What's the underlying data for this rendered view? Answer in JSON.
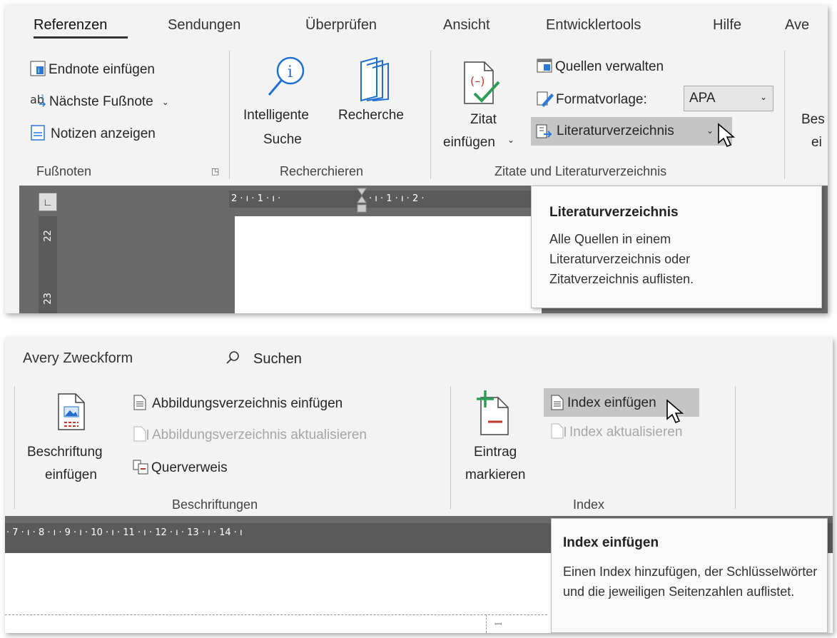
{
  "panel1": {
    "tabs": [
      "Referenzen",
      "Sendungen",
      "Überprüfen",
      "Ansicht",
      "Entwicklertools",
      "Hilfe",
      "Ave"
    ],
    "fussnoten": {
      "endnote": "Endnote einfügen",
      "naechste": "Nächste Fußnote",
      "notizen": "Notizen anzeigen",
      "group": "Fußnoten"
    },
    "recherche": {
      "intelligente_1": "Intelligente",
      "intelligente_2": "Suche",
      "recherche": "Recherche",
      "group": "Recherchieren"
    },
    "zitate": {
      "zitat_1": "Zitat",
      "zitat_2": "einfügen",
      "quellen": "Quellen verwalten",
      "formatvorlage": "Formatvorlage:",
      "style_value": "APA",
      "literatur": "Literaturverzeichnis",
      "group": "Zitate und Literaturverzeichnis"
    },
    "cut": {
      "l1": "Bes",
      "l2": "ei"
    },
    "ruler": {
      "h": "2 · ı · 1 · ı ·",
      "h2": "· ı · 1 · ı · 2 ·",
      "v1": "22",
      "v2": "23"
    },
    "tooltip": {
      "title": "Literaturverzeichnis",
      "body": "Alle Quellen in einem Literaturverzeichnis oder Zitatverzeichnis auflisten."
    }
  },
  "panel2": {
    "tabs": [
      "Avery Zweckform",
      "Suchen"
    ],
    "beschriftungen": {
      "besch_1": "Beschriftung",
      "besch_2": "einfügen",
      "abb_einf": "Abbildungsverzeichnis einfügen",
      "abb_akt": "Abbildungsverzeichnis aktualisieren",
      "querverweis": "Querverweis",
      "group": "Beschriftungen"
    },
    "index": {
      "eintrag_1": "Eintrag",
      "eintrag_2": "markieren",
      "index_einf": "Index einfügen",
      "index_akt": "Index aktualisieren",
      "group": "Index"
    },
    "ruler": {
      "h": "· 7 · ı · 8 · ı · 9 · ı · 10 · ı · 11 · ı · 12 · ı · 13 · ı · 14 · ı"
    },
    "tooltip": {
      "title": "Index einfügen",
      "body": "Einen Index hinzufügen, der Schlüsselwörter und die jeweiligen Seitenzahlen auflistet."
    }
  },
  "colors": {
    "ribbon": "#f3f3f3",
    "highlight": "#c5c5c5",
    "dark": "#6a6a6a",
    "citation_red": "#c0392b",
    "blue": "#1e6fd0"
  }
}
